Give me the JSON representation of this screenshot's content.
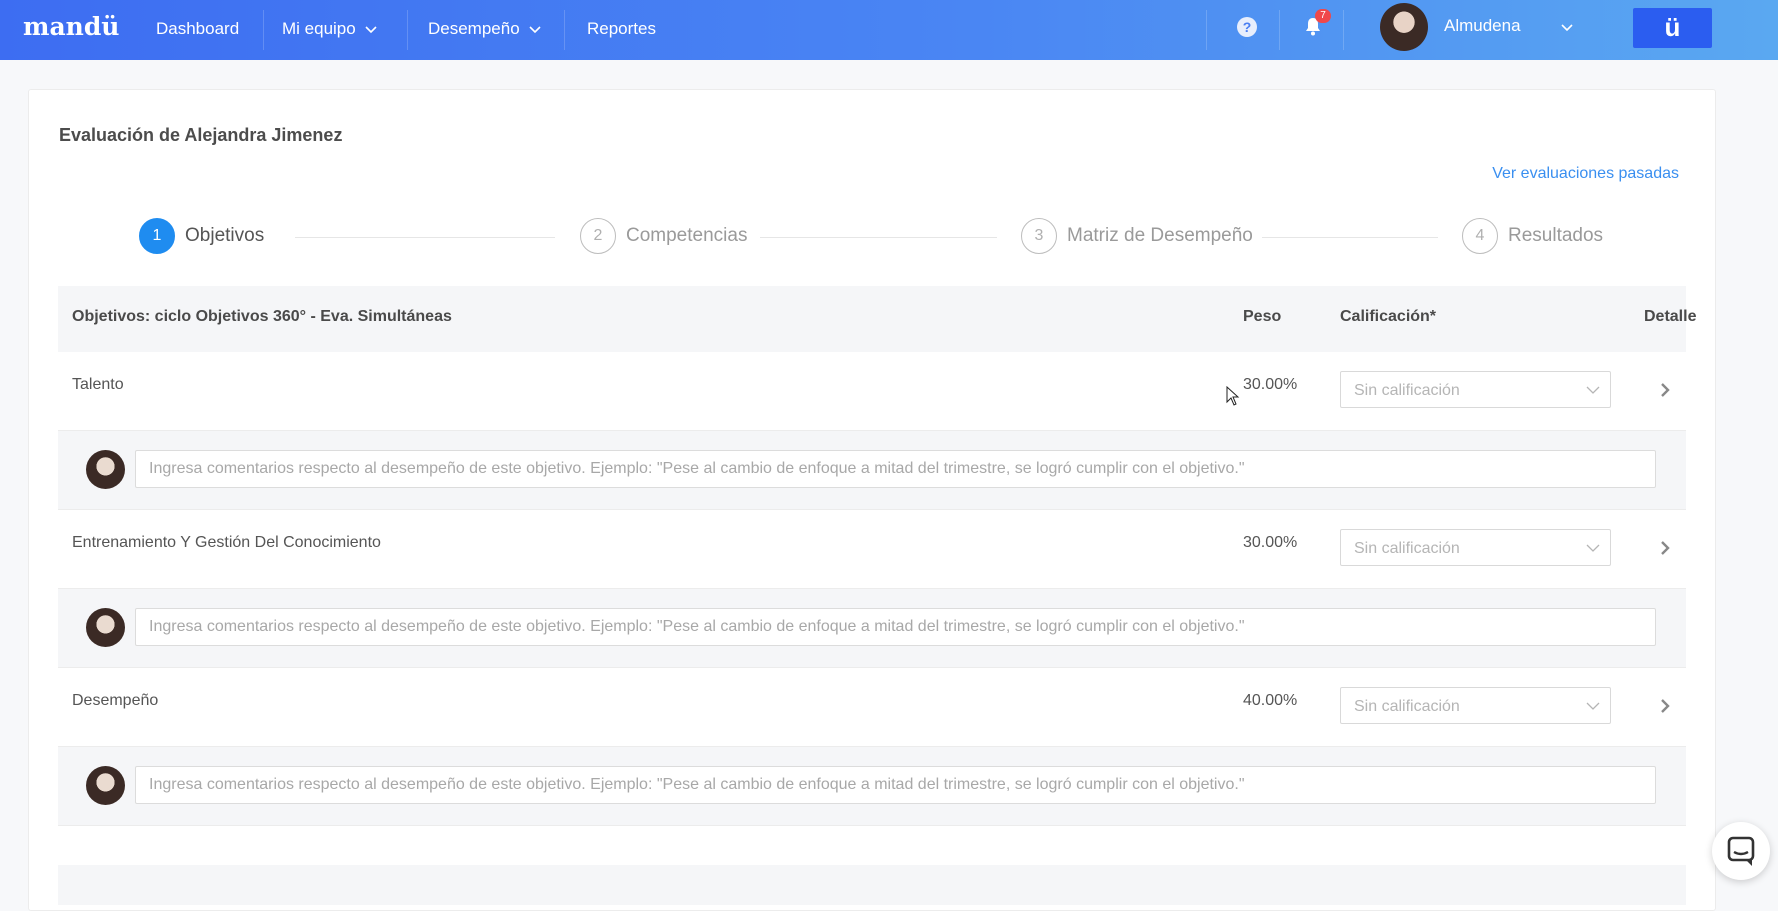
{
  "nav": {
    "logo": "mandü",
    "items": [
      {
        "label": "Dashboard"
      },
      {
        "label": "Mi equipo"
      },
      {
        "label": "Desempeño"
      },
      {
        "label": "Reportes"
      }
    ],
    "help_label": "?",
    "notifications_count": "7",
    "user_name": "Almudena",
    "brand_button": "ü"
  },
  "page": {
    "title": "Evaluación de Alejandra Jimenez",
    "past_link": "Ver evaluaciones pasadas"
  },
  "steps": [
    {
      "num": "1",
      "label": "Objetivos",
      "active": true
    },
    {
      "num": "2",
      "label": "Competencias",
      "active": false
    },
    {
      "num": "3",
      "label": "Matriz de Desempeño",
      "active": false
    },
    {
      "num": "4",
      "label": "Resultados",
      "active": false
    }
  ],
  "table": {
    "headers": {
      "objectives": "Objetivos: ciclo Objetivos 360° - Eva. Simultáneas",
      "peso": "Peso",
      "calificacion": "Calificación*",
      "detalle": "Detalle"
    },
    "rows": [
      {
        "name": "Talento",
        "peso": "30.00%",
        "rating": "Sin calificación"
      },
      {
        "name": "Entrenamiento Y Gestión Del Conocimiento",
        "peso": "30.00%",
        "rating": "Sin calificación"
      },
      {
        "name": "Desempeño",
        "peso": "40.00%",
        "rating": "Sin calificación"
      }
    ],
    "comment_placeholder": "Ingresa comentarios respecto al desempeño de este objetivo. Ejemplo: \"Pese al cambio de enfoque a mitad del trimestre, se logró cumplir con el objetivo.\""
  },
  "colors": {
    "nav_gradient_start": "#3d6df2",
    "nav_gradient_end": "#5aa8f1",
    "accent": "#1f8cf0",
    "link": "#3a8ff0",
    "badge": "#f0484a"
  }
}
